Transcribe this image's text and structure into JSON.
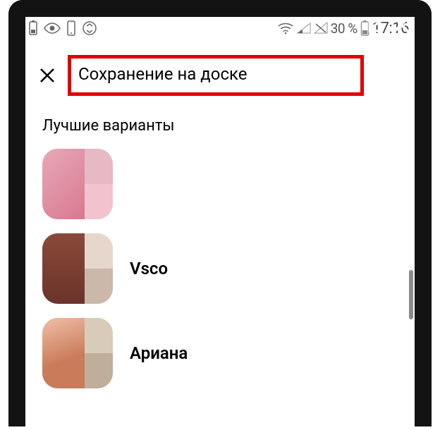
{
  "statusbar": {
    "battery_pct": "30 %",
    "clock": "17:16"
  },
  "header": {
    "title": "Сохранение на доске"
  },
  "section_label": "Лучшие варианты",
  "boards": [
    {
      "name": ""
    },
    {
      "name": "Vsco"
    },
    {
      "name": "Ариана"
    }
  ]
}
